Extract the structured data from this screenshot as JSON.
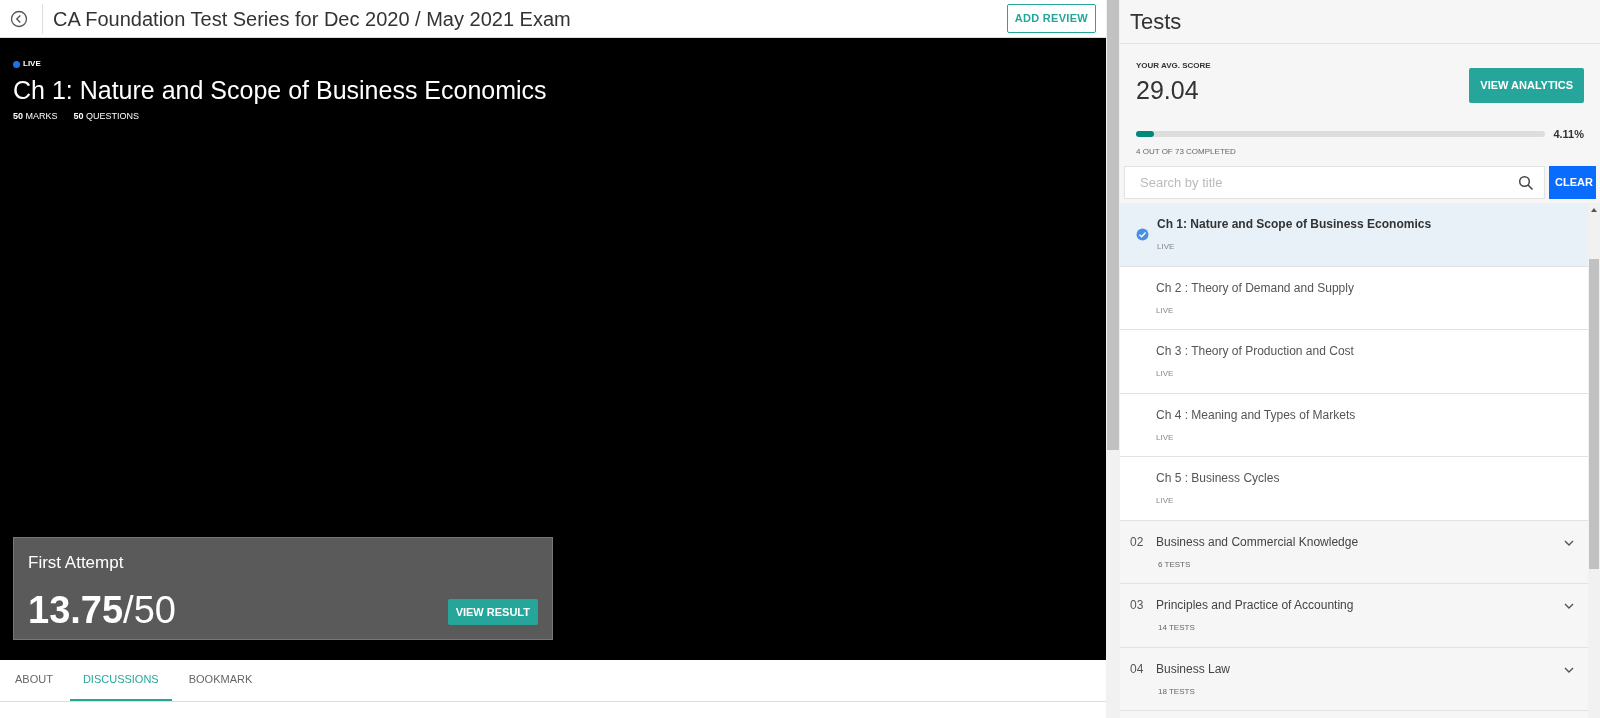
{
  "header": {
    "title": "CA Foundation Test Series for Dec 2020 / May 2021 Exam",
    "add_review_button": "ADD REVIEW"
  },
  "video": {
    "status": "LIVE",
    "title": "Ch 1: Nature and Scope of Business Economics",
    "stats": [
      "**50** MARKS",
      "**50** QUESTIONS"
    ],
    "attempt": {
      "title": "First Attempt",
      "score": "**13.75**/50",
      "button": "VIEW RESULT"
    }
  },
  "tabs": [
    {
      "label": "ABOUT",
      "selected": false
    },
    {
      "label": "DISCUSSIONS",
      "selected": true
    },
    {
      "label": "BOOKMARK",
      "selected": false
    }
  ],
  "sidebar": {
    "title": "Tests",
    "avg_label": "YOUR AVG. SCORE",
    "avg_value": "29.04",
    "analytics_button": "VIEW ANALYTICS",
    "progress": {
      "level": 0.0411,
      "reading": "4.11%"
    },
    "completed": "4 OUT OF 73 COMPLETED",
    "search": {
      "placeholder": "Search by title"
    },
    "clear_button": "CLEAR",
    "tests": [
      {
        "title": "Ch 1: Nature and Scope of Business Economics",
        "status": "LIVE",
        "selected": true
      },
      {
        "title": "Ch 2 : Theory of Demand and Supply",
        "status": "LIVE",
        "selected": false
      },
      {
        "title": "Ch 3 : Theory of Production and Cost",
        "status": "LIVE",
        "selected": false
      },
      {
        "title": "Ch 4 : Meaning and Types of Markets",
        "status": "LIVE",
        "selected": false
      },
      {
        "title": "Ch 5 : Business Cycles",
        "status": "LIVE",
        "selected": false
      }
    ],
    "sections": [
      {
        "number": "02",
        "title": "Business and Commercial Knowledge",
        "count": "6 TESTS",
        "expanded": false
      },
      {
        "number": "03",
        "title": "Principles and Practice of Accounting",
        "count": "14 TESTS",
        "expanded": false
      },
      {
        "number": "04",
        "title": "Business Law",
        "count": "18 TESTS",
        "expanded": false
      }
    ]
  }
}
